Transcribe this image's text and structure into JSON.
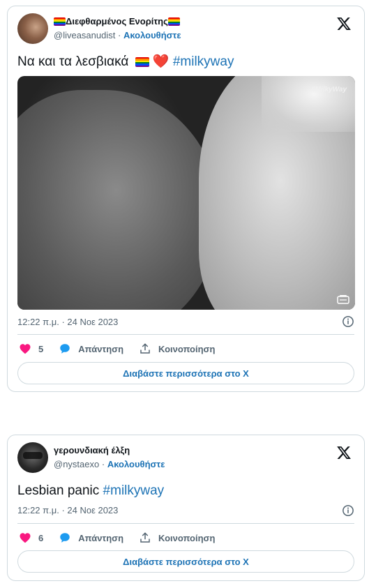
{
  "tweets": [
    {
      "display_name": "Διεφθαρμένος Ενορίτης",
      "handle": "@liveasanudist",
      "follow_label": "Ακολουθήστε",
      "text": "Να και τα λεσβιακά",
      "text_emoji": "❤️",
      "hashtag": "#milkyway",
      "media_watermark": "#MilkyWay",
      "timestamp": "12:22 π.μ. · 24 Νοε 2023",
      "like_count": "5",
      "reply_label": "Απάντηση",
      "share_label": "Κοινοποίηση",
      "read_more_label": "Διαβάστε περισσότερα στο X"
    },
    {
      "display_name": "γερουνδιακή έλξη",
      "handle": "@nystaexo",
      "follow_label": "Ακολουθήστε",
      "text": "Lesbian panic",
      "hashtag": "#milkyway",
      "timestamp": "12:22 π.μ. · 24 Νοε 2023",
      "like_count": "6",
      "reply_label": "Απάντηση",
      "share_label": "Κοινοποίηση",
      "read_more_label": "Διαβάστε περισσότερα στο X"
    }
  ],
  "colors": {
    "link": "#1d73b5",
    "like": "#f91880",
    "reply": "#1d9bf0",
    "muted": "#536471",
    "border": "#cfd9de"
  },
  "icons": [
    "x-logo-icon",
    "info-icon",
    "heart-icon",
    "reply-bubble-icon",
    "share-icon",
    "rainbow-flag-icon",
    "gallery-icon"
  ]
}
